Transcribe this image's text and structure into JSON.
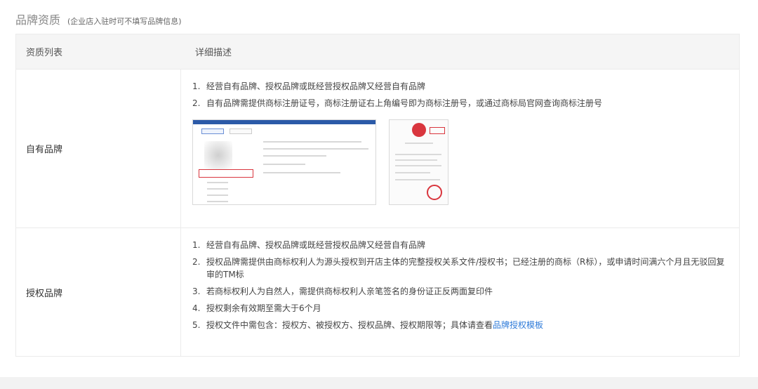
{
  "section": {
    "title": "品牌资质",
    "subtitle": "(企业店入驻时可不填写品牌信息)"
  },
  "table": {
    "headers": {
      "col1": "资质列表",
      "col2": "详细描述"
    },
    "rows": [
      {
        "name": "自有品牌",
        "items": [
          {
            "num": "1.",
            "text": "经营自有品牌、授权品牌或既经营授权品牌又经营自有品牌"
          },
          {
            "num": "2.",
            "text": "自有品牌需提供商标注册证号，商标注册证右上角编号即为商标注册号，或通过商标局官网查询商标注册号"
          }
        ]
      },
      {
        "name": "授权品牌",
        "items": [
          {
            "num": "1.",
            "text": "经营自有品牌、授权品牌或既经营授权品牌又经营自有品牌"
          },
          {
            "num": "2.",
            "text": "授权品牌需提供由商标权利人为源头授权到开店主体的完整授权关系文件/授权书；已经注册的商标（R标），或申请时间满六个月且无驳回复审的TM标"
          },
          {
            "num": "3.",
            "text": "若商标权利人为自然人，需提供商标权利人亲笔签名的身份证正反两面复印件"
          },
          {
            "num": "4.",
            "text": "授权剩余有效期至需大于6个月"
          },
          {
            "num": "5.",
            "text": "授权文件中需包含：授权方、被授权方、授权品牌、授权期限等；具体请查看",
            "link": "品牌授权模板"
          }
        ]
      }
    ]
  }
}
